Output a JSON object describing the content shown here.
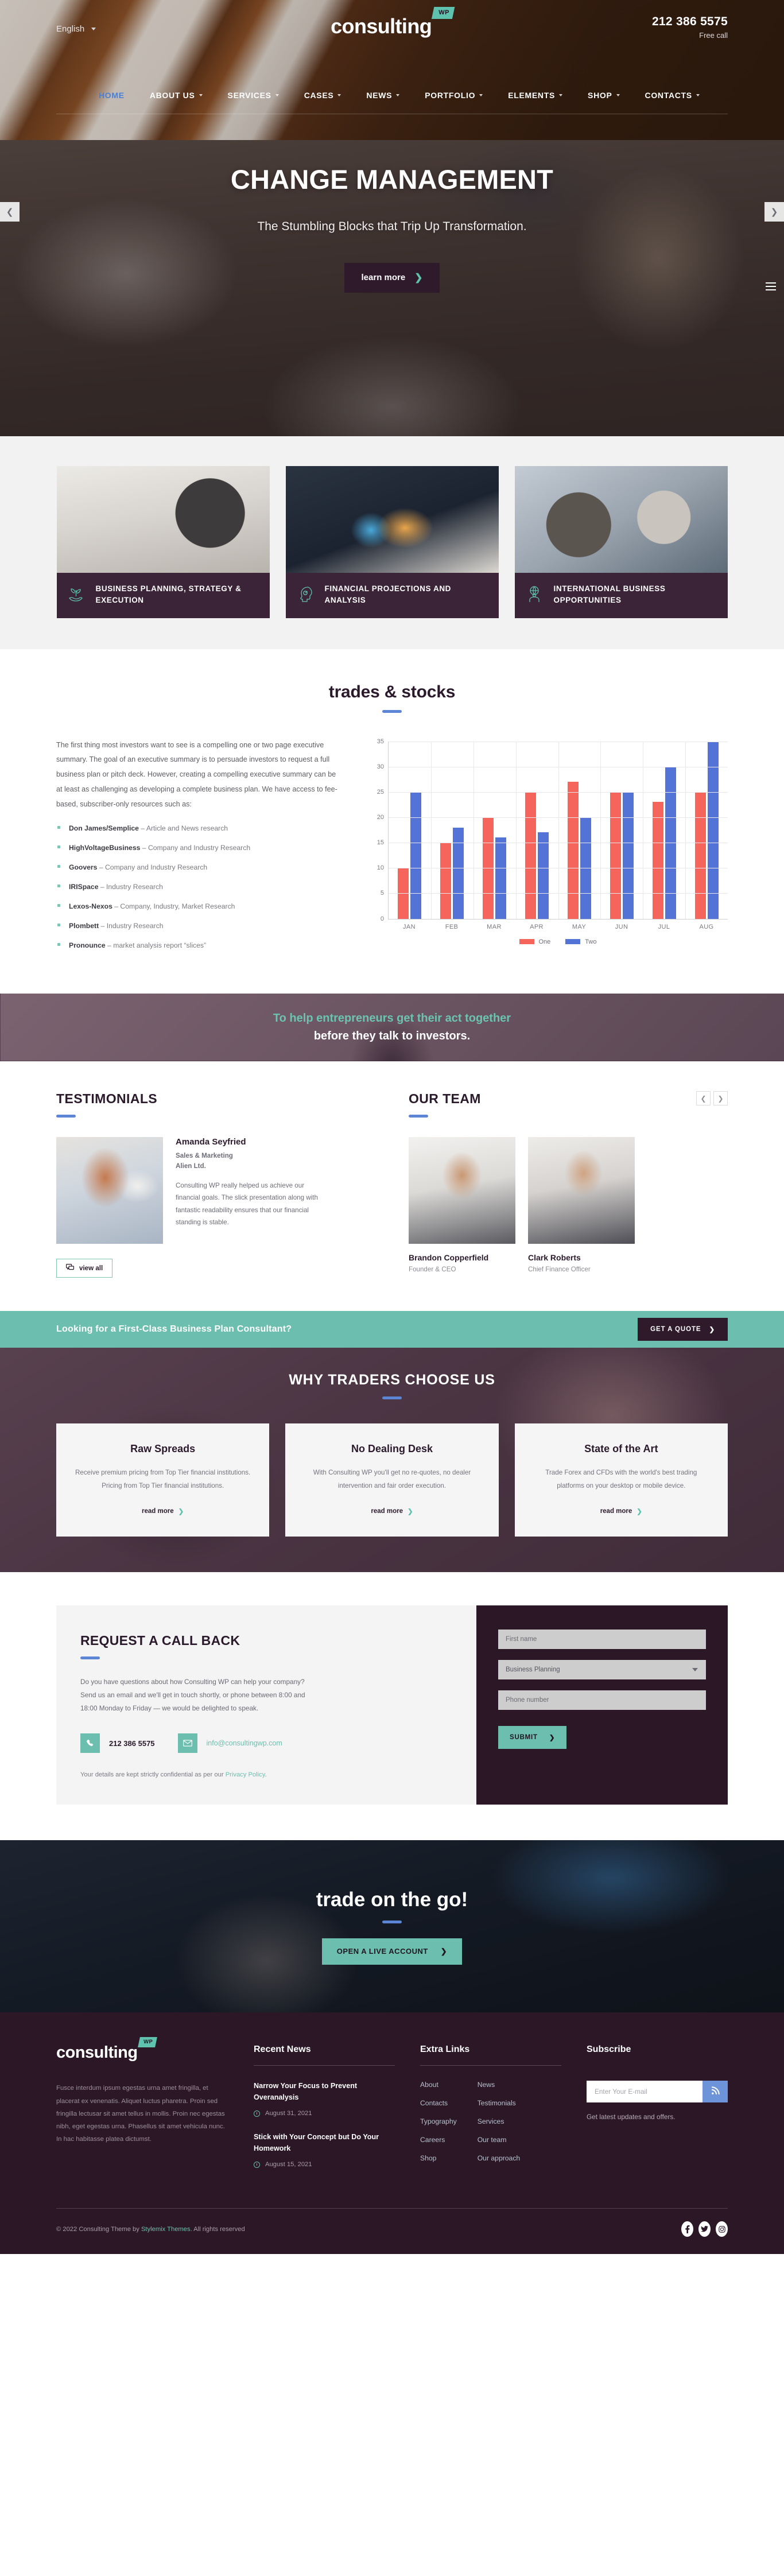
{
  "header": {
    "language": "English",
    "logo_word": "consulting",
    "logo_badge": "WP",
    "phone": "212 386 5575",
    "phone_label": "Free call",
    "nav": [
      {
        "label": "HOME",
        "active": true,
        "caret": false
      },
      {
        "label": "ABOUT US",
        "active": false,
        "caret": true
      },
      {
        "label": "SERVICES",
        "active": false,
        "caret": true
      },
      {
        "label": "CASES",
        "active": false,
        "caret": true
      },
      {
        "label": "NEWS",
        "active": false,
        "caret": true
      },
      {
        "label": "PORTFOLIO",
        "active": false,
        "caret": true
      },
      {
        "label": "ELEMENTS",
        "active": false,
        "caret": true
      },
      {
        "label": "SHOP",
        "active": false,
        "caret": true
      },
      {
        "label": "CONTACTS",
        "active": false,
        "caret": true
      }
    ]
  },
  "hero": {
    "title": "CHANGE MANAGEMENT",
    "subtitle": "The Stumbling Blocks that Trip Up Transformation.",
    "cta": "learn more",
    "prev_icon": "chevron-left-icon",
    "next_icon": "chevron-right-icon"
  },
  "feature_cards": [
    {
      "label": "BUSINESS PLANNING, STRATEGY & EXECUTION",
      "icon": "plant-in-hand-icon"
    },
    {
      "label": "FINANCIAL PROJECTIONS AND ANALYSIS",
      "icon": "head-profile-icon"
    },
    {
      "label": "INTERNATIONAL BUSINESS OPPORTUNITIES",
      "icon": "globe-person-icon"
    }
  ],
  "trades": {
    "title": "trades & stocks",
    "paragraph": "The first thing most investors want to see is a compelling one or two page executive summary. The goal of an executive summary is to persuade investors to request a full business plan or pitch deck. However, creating a compelling executive summary can be at least as challenging as developing a complete business plan. We have access to fee-based, subscriber-only resources such as:",
    "bullets": [
      {
        "name": "Don James/Semplice",
        "desc": " – Article and News research"
      },
      {
        "name": "HighVoltageBusiness",
        "desc": " – Company and Industry Research"
      },
      {
        "name": "Goovers",
        "desc": " – Company and Industry Research"
      },
      {
        "name": "IRISpace",
        "desc": " – Industry Research"
      },
      {
        "name": "Lexos-Nexos",
        "desc": " – Company, Industry, Market Research"
      },
      {
        "name": "Plombett",
        "desc": " – Industry Research"
      },
      {
        "name": "Pronounce",
        "desc": " – market analysis report “slices”"
      }
    ]
  },
  "chart_data": {
    "type": "bar",
    "title": "",
    "xlabel": "",
    "ylabel": "",
    "categories": [
      "JAN",
      "FEB",
      "MAR",
      "APR",
      "MAY",
      "JUN",
      "JUL",
      "AUG"
    ],
    "series": [
      {
        "name": "One",
        "color": "#f5655c",
        "values": [
          10,
          15,
          20,
          25,
          27,
          25,
          23,
          25
        ]
      },
      {
        "name": "Two",
        "color": "#5473d6",
        "values": [
          25,
          18,
          16,
          17,
          20,
          25,
          30,
          35
        ]
      }
    ],
    "ylim": [
      0,
      35
    ],
    "yticks": [
      0,
      5,
      10,
      15,
      20,
      25,
      30,
      35
    ],
    "grid": true,
    "legend_position": "bottom"
  },
  "quote_band": {
    "line1": "To help entrepreneurs get their act together",
    "line2": "before they talk to investors."
  },
  "testimonials": {
    "title": "TESTIMONIALS",
    "name": "Amanda Seyfried",
    "role_line1": "Sales & Marketing",
    "role_line2": "Alien Ltd.",
    "text": "Consulting WP really helped us achieve our financial goals. The slick presentation along with fantastic readability ensures that our financial standing is stable.",
    "view_all": "view all",
    "view_all_icon": "speech-bubbles-icon"
  },
  "team": {
    "title": "OUR TEAM",
    "prev_icon": "chevron-left-icon",
    "next_icon": "chevron-right-icon",
    "members": [
      {
        "name": "Brandon Copperfield",
        "role": "Founder & CEO"
      },
      {
        "name": "Clark Roberts",
        "role": "Chief Finance Officer"
      }
    ]
  },
  "teal_cta": {
    "text": "Looking for a First-Class Business Plan Consultant?",
    "button": "GET A QUOTE"
  },
  "why": {
    "title": "WHY TRADERS CHOOSE US",
    "cards": [
      {
        "heading": "Raw Spreads",
        "text": "Receive premium pricing from Top Tier financial institutions. Pricing from Top Tier financial institutions.",
        "link": "read more"
      },
      {
        "heading": "No Dealing Desk",
        "text": "With Consulting WP you'll get no re-quotes, no dealer intervention and fair order execution.",
        "link": "read more"
      },
      {
        "heading": "State of the Art",
        "text": "Trade Forex and CFDs with the world's best trading platforms on your desktop or mobile device.",
        "link": "read more"
      }
    ]
  },
  "callback": {
    "title": "REQUEST A CALL BACK",
    "paragraph": "Do you have questions about how Consulting WP can help your company? Send us an email and we'll get in touch shortly, or phone between 8:00 and 18:00 Monday to Friday — we would be delighted to speak.",
    "phone": "212 386 5575",
    "phone_icon": "phone-icon",
    "email": "info@consultingwp.com",
    "email_icon": "envelope-icon",
    "note_prefix": "Your details are kept strictly confidential as per our ",
    "note_link": "Privacy Policy",
    "note_suffix": ".",
    "form": {
      "first_name_placeholder": "First name",
      "service_value": "Business Planning",
      "service_options": [
        "Business Planning"
      ],
      "phone_placeholder": "Phone number",
      "submit": "SUBMIT"
    }
  },
  "trade_go": {
    "title": "trade on the go!",
    "button": "OPEN A LIVE ACCOUNT"
  },
  "footer": {
    "logo_word": "consulting",
    "logo_badge": "WP",
    "about": "Fusce interdum ipsum egestas urna amet fringilla, et placerat ex venenatis. Aliquet luctus pharetra. Proin sed fringilla lectusar sit amet tellus in mollis. Proin nec egestas nibh, eget egestas urna. Phasellus sit amet vehicula nunc. In hac habitasse platea dictumst.",
    "news_heading": "Recent News",
    "news": [
      {
        "title": "Narrow Your Focus to Prevent Overanalysis",
        "date": "August 31, 2021"
      },
      {
        "title": "Stick with Your Concept but Do Your Homework",
        "date": "August 15, 2021"
      }
    ],
    "links_heading": "Extra Links",
    "links_col1": [
      "About",
      "Contacts",
      "Typography",
      "Careers",
      "Shop"
    ],
    "links_col2": [
      "News",
      "Testimonials",
      "Services",
      "Our team",
      "Our approach"
    ],
    "subscribe_heading": "Subscribe",
    "subscribe_placeholder": "Enter Your E-mail",
    "subscribe_icon": "rss-icon",
    "subscribe_note": "Get latest updates and offers.",
    "copyright_prefix": "© 2022 Consulting Theme by ",
    "copyright_link": "Stylemix Themes",
    "copyright_suffix": ". All rights reserved",
    "socials": [
      {
        "icon": "facebook-icon",
        "glyph": "f"
      },
      {
        "icon": "twitter-icon",
        "glyph": "✉"
      },
      {
        "icon": "instagram-icon",
        "glyph": "□"
      }
    ]
  },
  "colors": {
    "teal": "#6cbfae",
    "plum": "#2b1726",
    "blue": "#5c85d6",
    "bar_one": "#f5655c",
    "bar_two": "#5473d6"
  }
}
